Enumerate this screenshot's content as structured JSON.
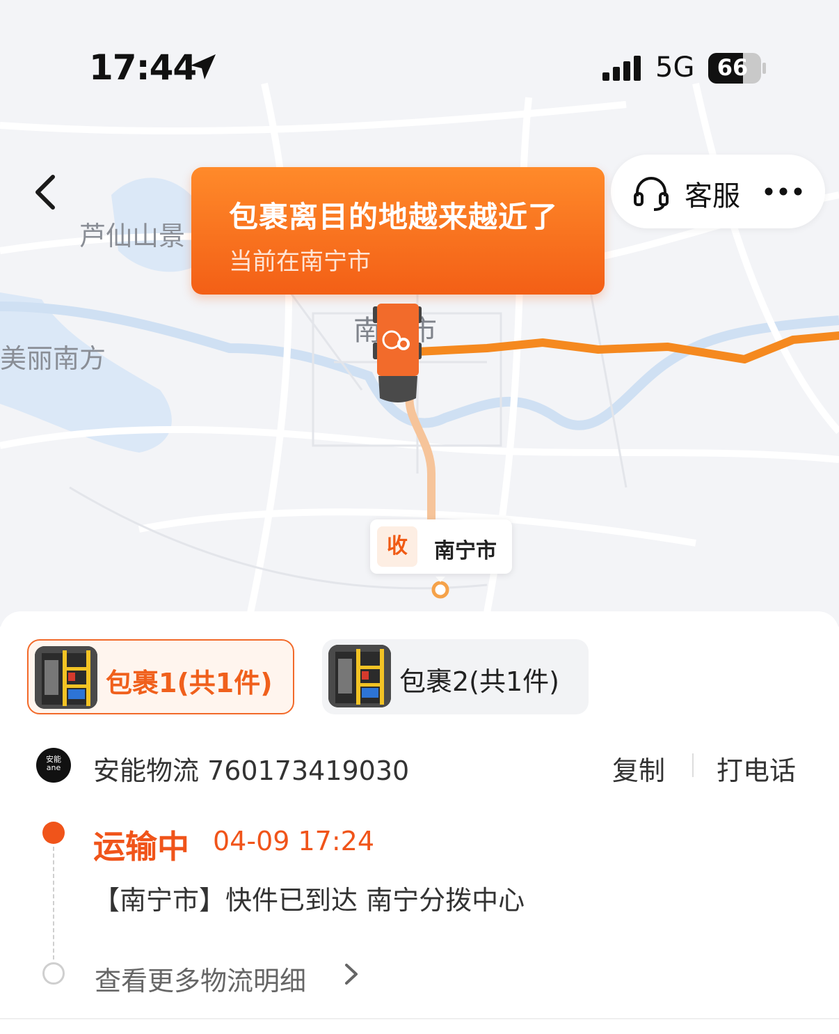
{
  "status_bar": {
    "time": "17:44",
    "network": "5G",
    "battery": "66"
  },
  "map": {
    "labels": {
      "lushan": "芦仙山景",
      "meili": "美丽南方",
      "city": "南宁市"
    }
  },
  "header": {
    "service_label": "客服"
  },
  "banner": {
    "title": "包裹离目的地越来越近了",
    "subtitle": "当前在南宁市"
  },
  "receiver": {
    "badge": "收",
    "city": "南宁市"
  },
  "tabs": [
    {
      "label": "包裹1(共1件)",
      "active": true
    },
    {
      "label": "包裹2(共1件)",
      "active": false
    }
  ],
  "carrier": {
    "logo_text": "安能",
    "logo_sub": "ane",
    "name_and_number": "安能物流 760173419030",
    "copy_label": "复制",
    "call_label": "打电话"
  },
  "tracking": {
    "status": "运输中",
    "time": "04-09 17:24",
    "description": "【南宁市】快件已到达 南宁分拨中心",
    "more_label": "查看更多物流明细"
  },
  "colors": {
    "accent": "#f0541a",
    "route": "#f5891f",
    "route_done": "#f6c49a"
  }
}
